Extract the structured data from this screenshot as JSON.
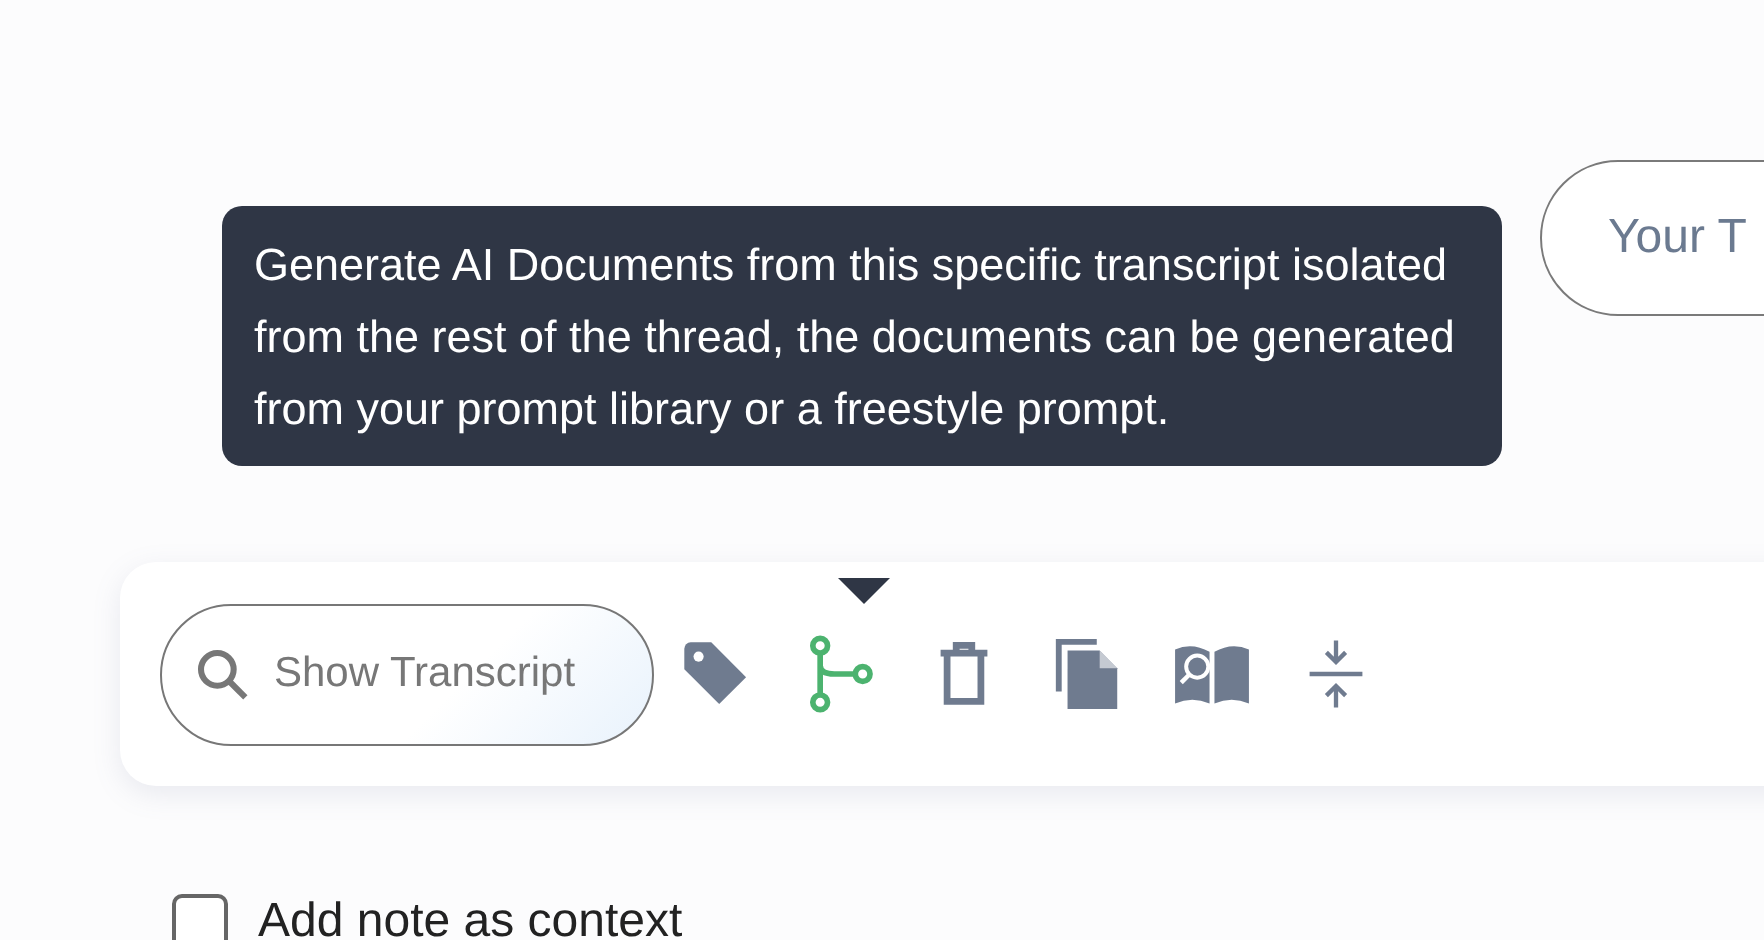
{
  "top_button": {
    "label": "Your T"
  },
  "tooltip": {
    "text": "Generate AI Documents from this specific transcript isolated from the rest of the thread, the documents can be generated from your prompt library or a freestyle prompt."
  },
  "toolbar": {
    "search_button": "Show Transcript",
    "tools": [
      {
        "kind": "tag",
        "selected": false
      },
      {
        "kind": "branch",
        "selected": true
      },
      {
        "kind": "trash",
        "selected": false
      },
      {
        "kind": "copy",
        "selected": false
      },
      {
        "kind": "book",
        "selected": false
      },
      {
        "kind": "compress",
        "selected": false
      }
    ]
  },
  "note_option": {
    "label": "Add note as context",
    "checked": false
  }
}
